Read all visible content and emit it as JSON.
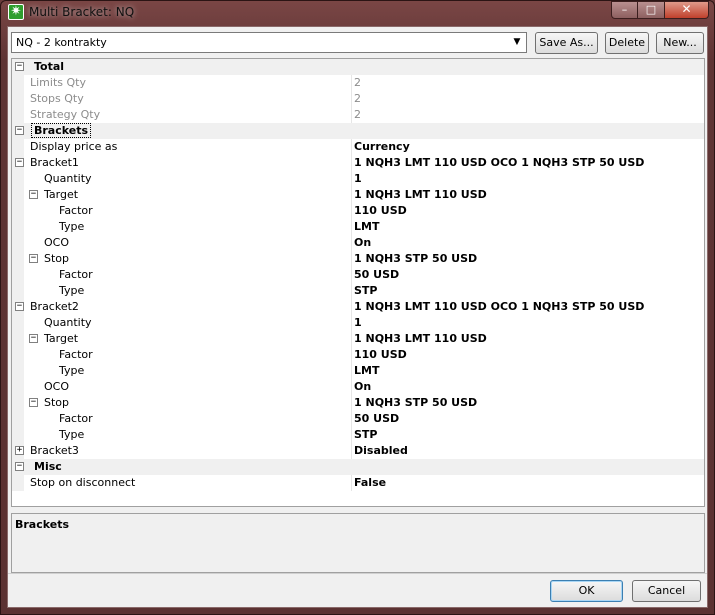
{
  "window": {
    "title": "Multi Bracket: NQ"
  },
  "toolbar": {
    "selected_preset": "NQ - 2 kontrakty",
    "save_as_label": "Save As...",
    "delete_label": "Delete",
    "new_label": "New..."
  },
  "rows": [
    {
      "level": 0,
      "type": "category",
      "expander": "⊟",
      "name": "Total",
      "value": ""
    },
    {
      "level": 1,
      "type": "readonly",
      "expander": "",
      "name": "Limits Qty",
      "value": "2"
    },
    {
      "level": 1,
      "type": "readonly",
      "expander": "",
      "name": "Stops Qty",
      "value": "2"
    },
    {
      "level": 1,
      "type": "readonly",
      "expander": "",
      "name": "Strategy Qty",
      "value": "2"
    },
    {
      "level": 0,
      "type": "category",
      "expander": "⊟",
      "name": "Brackets",
      "value": "",
      "selected": true
    },
    {
      "level": 1,
      "type": "prop",
      "expander": "",
      "name": "Display price as",
      "value": "Currency"
    },
    {
      "level": 1,
      "type": "prop",
      "expander": "⊟",
      "name": "Bracket1",
      "value": "1 NQH3 LMT 110 USD OCO 1 NQH3 STP 50 USD"
    },
    {
      "level": 2,
      "type": "prop",
      "expander": "",
      "name": "Quantity",
      "value": "1"
    },
    {
      "level": 2,
      "type": "prop",
      "expander": "⊟",
      "name": "Target",
      "value": "1 NQH3 LMT 110 USD"
    },
    {
      "level": 3,
      "type": "prop",
      "expander": "",
      "name": "Factor",
      "value": "110 USD"
    },
    {
      "level": 3,
      "type": "prop",
      "expander": "",
      "name": "Type",
      "value": "LMT"
    },
    {
      "level": 2,
      "type": "prop",
      "expander": "",
      "name": "OCO",
      "value": "On"
    },
    {
      "level": 2,
      "type": "prop",
      "expander": "⊟",
      "name": "Stop",
      "value": "1 NQH3 STP 50 USD"
    },
    {
      "level": 3,
      "type": "prop",
      "expander": "",
      "name": "Factor",
      "value": "50 USD"
    },
    {
      "level": 3,
      "type": "prop",
      "expander": "",
      "name": "Type",
      "value": "STP"
    },
    {
      "level": 1,
      "type": "prop",
      "expander": "⊟",
      "name": "Bracket2",
      "value": "1 NQH3 LMT 110 USD OCO 1 NQH3 STP 50 USD"
    },
    {
      "level": 2,
      "type": "prop",
      "expander": "",
      "name": "Quantity",
      "value": "1"
    },
    {
      "level": 2,
      "type": "prop",
      "expander": "⊟",
      "name": "Target",
      "value": "1 NQH3 LMT 110 USD"
    },
    {
      "level": 3,
      "type": "prop",
      "expander": "",
      "name": "Factor",
      "value": "110 USD"
    },
    {
      "level": 3,
      "type": "prop",
      "expander": "",
      "name": "Type",
      "value": "LMT"
    },
    {
      "level": 2,
      "type": "prop",
      "expander": "",
      "name": "OCO",
      "value": "On"
    },
    {
      "level": 2,
      "type": "prop",
      "expander": "⊟",
      "name": "Stop",
      "value": "1 NQH3 STP 50 USD"
    },
    {
      "level": 3,
      "type": "prop",
      "expander": "",
      "name": "Factor",
      "value": "50 USD"
    },
    {
      "level": 3,
      "type": "prop",
      "expander": "",
      "name": "Type",
      "value": "STP"
    },
    {
      "level": 1,
      "type": "prop",
      "expander": "⊞",
      "name": "Bracket3",
      "value": "Disabled"
    },
    {
      "level": 0,
      "type": "category",
      "expander": "⊟",
      "name": "Misc",
      "value": ""
    },
    {
      "level": 1,
      "type": "prop",
      "expander": "",
      "name": "Stop on disconnect",
      "value": "False"
    }
  ],
  "description": {
    "title": "Brackets"
  },
  "footer": {
    "ok_label": "OK",
    "cancel_label": "Cancel"
  }
}
